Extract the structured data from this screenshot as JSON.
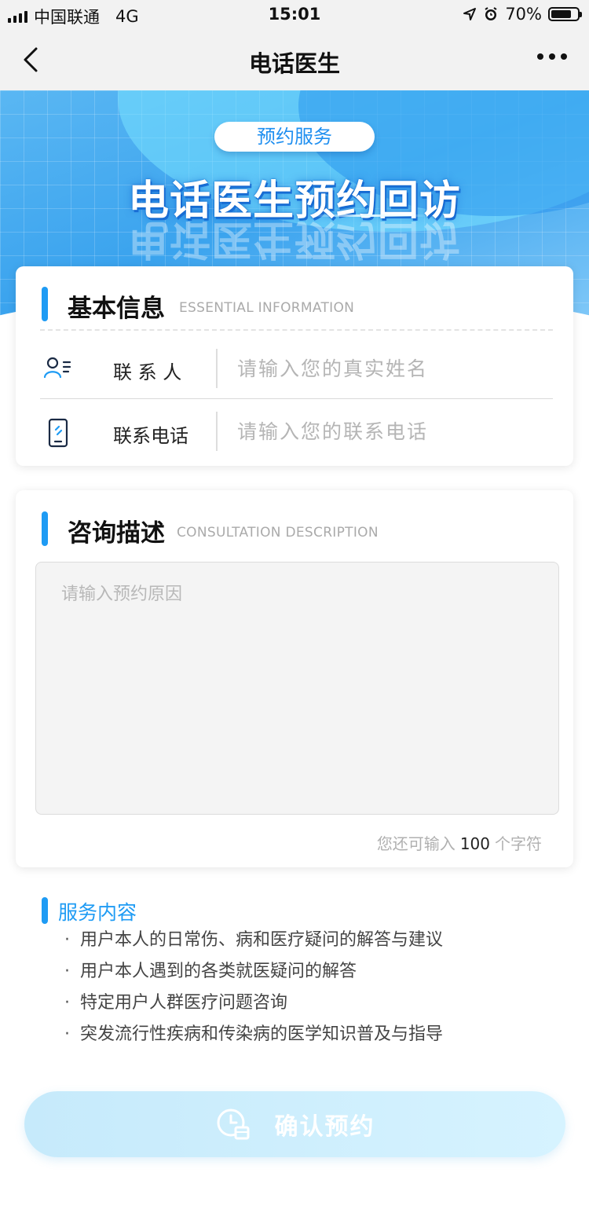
{
  "status_bar": {
    "carrier": "中国联通",
    "network": "4G",
    "time": "15:01",
    "battery": "70%"
  },
  "nav": {
    "title": "电话医生"
  },
  "banner": {
    "badge": "预约服务",
    "title": "电话医生预约回访"
  },
  "basic_info": {
    "title": "基本信息",
    "subtitle": "ESSENTIAL INFORMATION",
    "fields": [
      {
        "label": "联 系 人",
        "placeholder": "请输入您的真实姓名",
        "icon": "contact-person-icon"
      },
      {
        "label": "联系电话",
        "placeholder": "请输入您的联系电话",
        "icon": "phone-icon"
      }
    ]
  },
  "consultation": {
    "title": "咨询描述",
    "subtitle": "CONSULTATION DESCRIPTION",
    "placeholder": "请输入预约原因",
    "counter_prefix": "您还可输入",
    "counter_value": "100",
    "counter_suffix": "个字符"
  },
  "service": {
    "title": "服务内容",
    "items": [
      "用户本人的日常伤、病和医疗疑问的解答与建议",
      "用户本人遇到的各类就医疑问的解答",
      "特定用户人群医疗问题咨询",
      "突发流行性疾病和传染病的医学知识普及与指导"
    ]
  },
  "confirm": {
    "label": "确认预约",
    "icon": "clock-calendar-icon"
  },
  "colors": {
    "accent": "#1e9bf4",
    "button_bg": "#c6eafb"
  }
}
